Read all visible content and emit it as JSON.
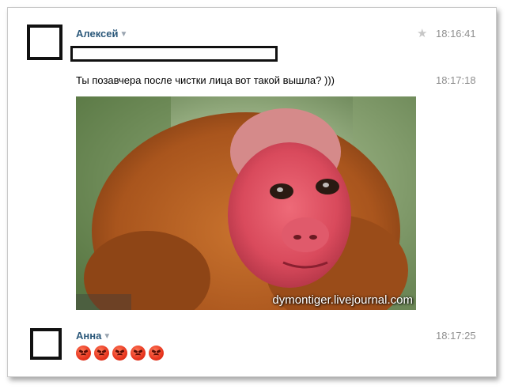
{
  "messages": [
    {
      "author": "Алексей",
      "time": "18:16:41"
    },
    {
      "text": "Ты позавчера после чистки лица вот такой вышла? )))",
      "time": "18:17:18",
      "image": {
        "watermark": "dymontiger.livejournal.com"
      }
    },
    {
      "author": "Анна",
      "time": "18:17:25",
      "emoji_icons": [
        "angry-face-icon",
        "angry-face-icon",
        "angry-face-icon",
        "angry-face-icon",
        "angry-face-icon"
      ]
    }
  ],
  "icons": {
    "star": "star-icon",
    "author_menu": "chevron-down-icon"
  }
}
